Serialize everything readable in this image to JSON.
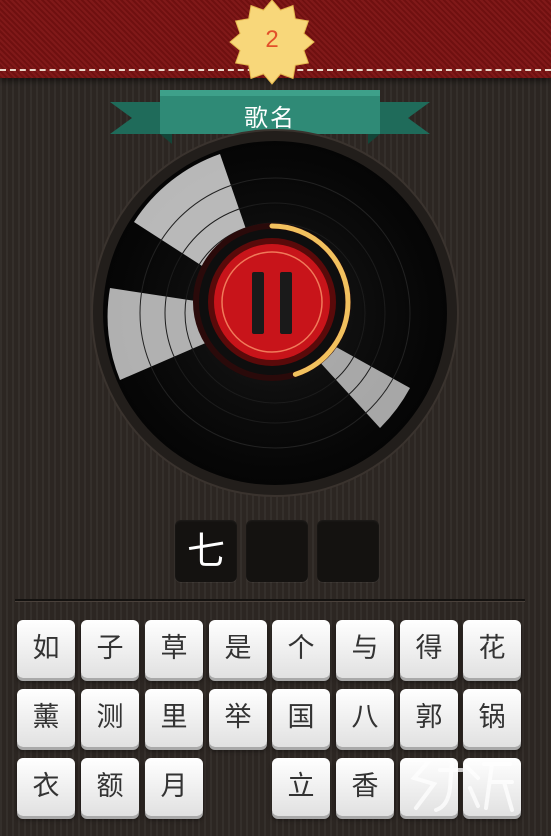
{
  "header": {
    "level": "2"
  },
  "category": {
    "title": "歌名"
  },
  "player": {
    "state": "paused",
    "progress_percent": 45
  },
  "answer": {
    "slots": [
      "七",
      "",
      ""
    ]
  },
  "keyboard": {
    "rows": [
      [
        "如",
        "子",
        "草",
        "是",
        "个",
        "与",
        "得",
        "花"
      ],
      [
        "薰",
        "测",
        "里",
        "举",
        "国",
        "八",
        "郭",
        "锅"
      ],
      [
        "衣",
        "额",
        "月",
        "",
        "立",
        "香",
        "",
        ""
      ]
    ]
  },
  "colors": {
    "banner": "#7c1212",
    "ribbon": "#2f8a76",
    "badge": "#f8d77a",
    "play_button": "#c8141a",
    "progress_arc": "#f2c15e"
  }
}
